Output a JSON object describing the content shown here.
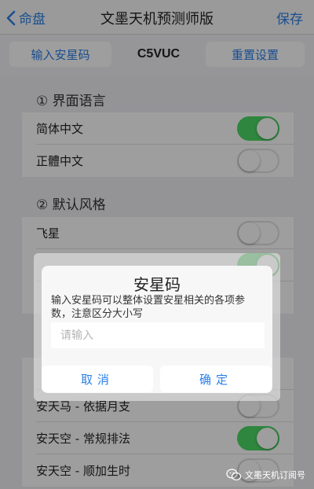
{
  "navbar": {
    "back_label": "命盘",
    "title": "文墨天机预测师版",
    "save_label": "保存"
  },
  "toolbar": {
    "left_button": "输入安星码",
    "code": "C5VUC",
    "right_button": "重置设置"
  },
  "sections": {
    "language": {
      "title": "① 界面语言",
      "items": [
        {
          "label": "简体中文",
          "on": true
        },
        {
          "label": "正體中文",
          "on": false
        }
      ]
    },
    "style": {
      "title": "② 默认风格",
      "items": [
        {
          "label": "飞星",
          "on": false
        }
      ]
    },
    "stars": {
      "items": [
        {
          "label": "安天马 - 依据月支",
          "on": false
        },
        {
          "label": "安天空 - 常规排法",
          "on": true
        },
        {
          "label": "安天空 - 顺加生时",
          "on": false
        }
      ]
    }
  },
  "dialog": {
    "title": "安星码",
    "message": "输入安星码可以整体设置安星相关的各项参数，注意区分大小写",
    "placeholder": "请输入",
    "cancel_label": "取消",
    "ok_label": "确定"
  },
  "watermark": {
    "text": "文墨天机订阅号"
  },
  "colors": {
    "accent": "#2a7fe8",
    "switch_on": "#4cd964"
  }
}
